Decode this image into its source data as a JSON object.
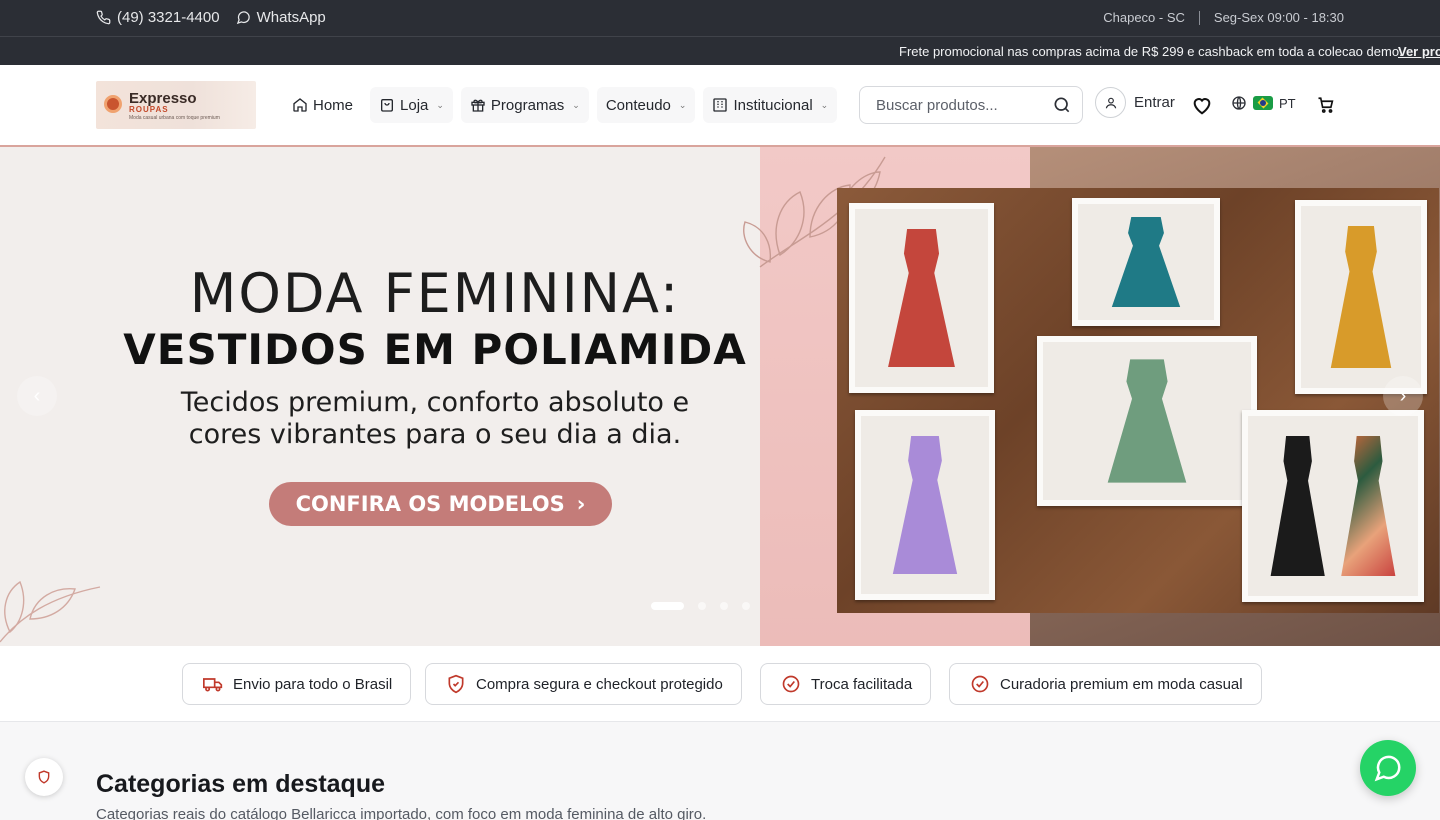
{
  "topbar": {
    "phone": "(49) 3321-4400",
    "whatsapp": "WhatsApp",
    "location": "Chapeco - SC",
    "hours": "Seg-Sex 09:00 - 18:30"
  },
  "promo": {
    "text": "Frete promocional nas compras acima de R$ 299 e cashback em toda a colecao demo.",
    "link": "Ver pro"
  },
  "logo": {
    "brand": "Expresso",
    "sub": "ROUPAS",
    "tagline": "Moda casual urbana com toque premium"
  },
  "nav": {
    "home": "Home",
    "loja": "Loja",
    "programas": "Programas",
    "conteudo": "Conteudo",
    "institucional": "Institucional"
  },
  "search": {
    "placeholder": "Buscar produtos..."
  },
  "account": {
    "login": "Entrar"
  },
  "language": {
    "code": "PT"
  },
  "hero": {
    "title_line1": "MODA FEMININA:",
    "title_line2": "VESTIDOS EM POLIAMIDA",
    "subtitle_line1": "Tecidos premium, conforto absoluto e",
    "subtitle_line2": "cores vibrantes para o seu dia a dia.",
    "cta": "CONFIRA OS MODELOS",
    "slides_total": 4,
    "active_slide": 1
  },
  "features": [
    {
      "label": "Envio para todo o Brasil",
      "icon": "truck-icon"
    },
    {
      "label": "Compra segura e checkout protegido",
      "icon": "shield-icon"
    },
    {
      "label": "Troca facilitada",
      "icon": "check-circle-icon"
    },
    {
      "label": "Curadoria premium em moda casual",
      "icon": "check-circle-icon"
    }
  ],
  "categories": {
    "title": "Categorias em destaque",
    "subtitle": "Categorias reais do catálogo Bellaricca importado, com foco em moda feminina de alto giro."
  },
  "colors": {
    "accent": "#c47c79",
    "topbar": "#2b2e35",
    "whatsapp": "#25d366",
    "feature_icon": "#c0392b"
  }
}
